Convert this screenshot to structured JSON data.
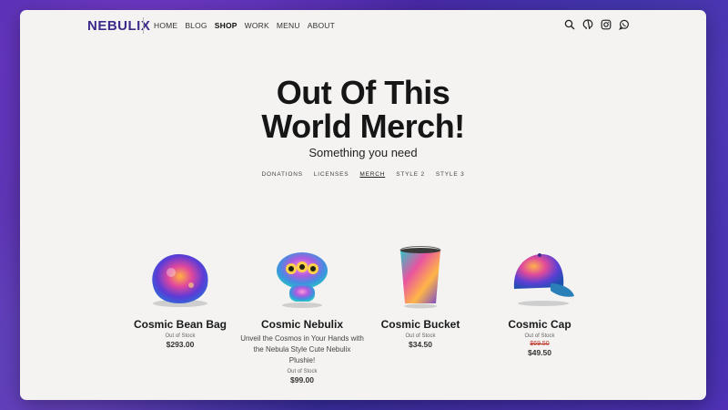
{
  "header": {
    "logo": "NEBULIX",
    "nav": [
      {
        "label": "HOME"
      },
      {
        "label": "BLOG"
      },
      {
        "label": "SHOP",
        "active": true
      },
      {
        "label": "WORK"
      },
      {
        "label": "MENU"
      },
      {
        "label": "ABOUT"
      }
    ],
    "icons": [
      "search-icon",
      "github-icon",
      "instagram-icon",
      "whatsapp-icon"
    ]
  },
  "hero": {
    "title_line1": "Out Of This",
    "title_line2": "World Merch!",
    "subtitle": "Something you need"
  },
  "tabs": [
    {
      "label": "DONATIONS"
    },
    {
      "label": "LICENSES"
    },
    {
      "label": "MERCH",
      "active": true
    },
    {
      "label": "STYLE 2"
    },
    {
      "label": "STYLE 3"
    }
  ],
  "products": [
    {
      "name": "Cosmic Bean Bag",
      "stock": "Out of Stock",
      "price": "$293.00"
    },
    {
      "name": "Cosmic Nebulix",
      "description": "Unveil the Cosmos in Your Hands with the Nebula Style Cute Nebulix Plushie!",
      "stock": "Out of Stock",
      "price": "$99.00"
    },
    {
      "name": "Cosmic Bucket",
      "stock": "Out of Stock",
      "price": "$34.50"
    },
    {
      "name": "Cosmic Cap",
      "stock": "Out of Stock",
      "old_price": "$69.50",
      "price": "$49.50"
    }
  ],
  "colors": {
    "brand": "#3d2a8a",
    "page_background": "#f4f3f2",
    "sale_strike": "#c0392b"
  }
}
